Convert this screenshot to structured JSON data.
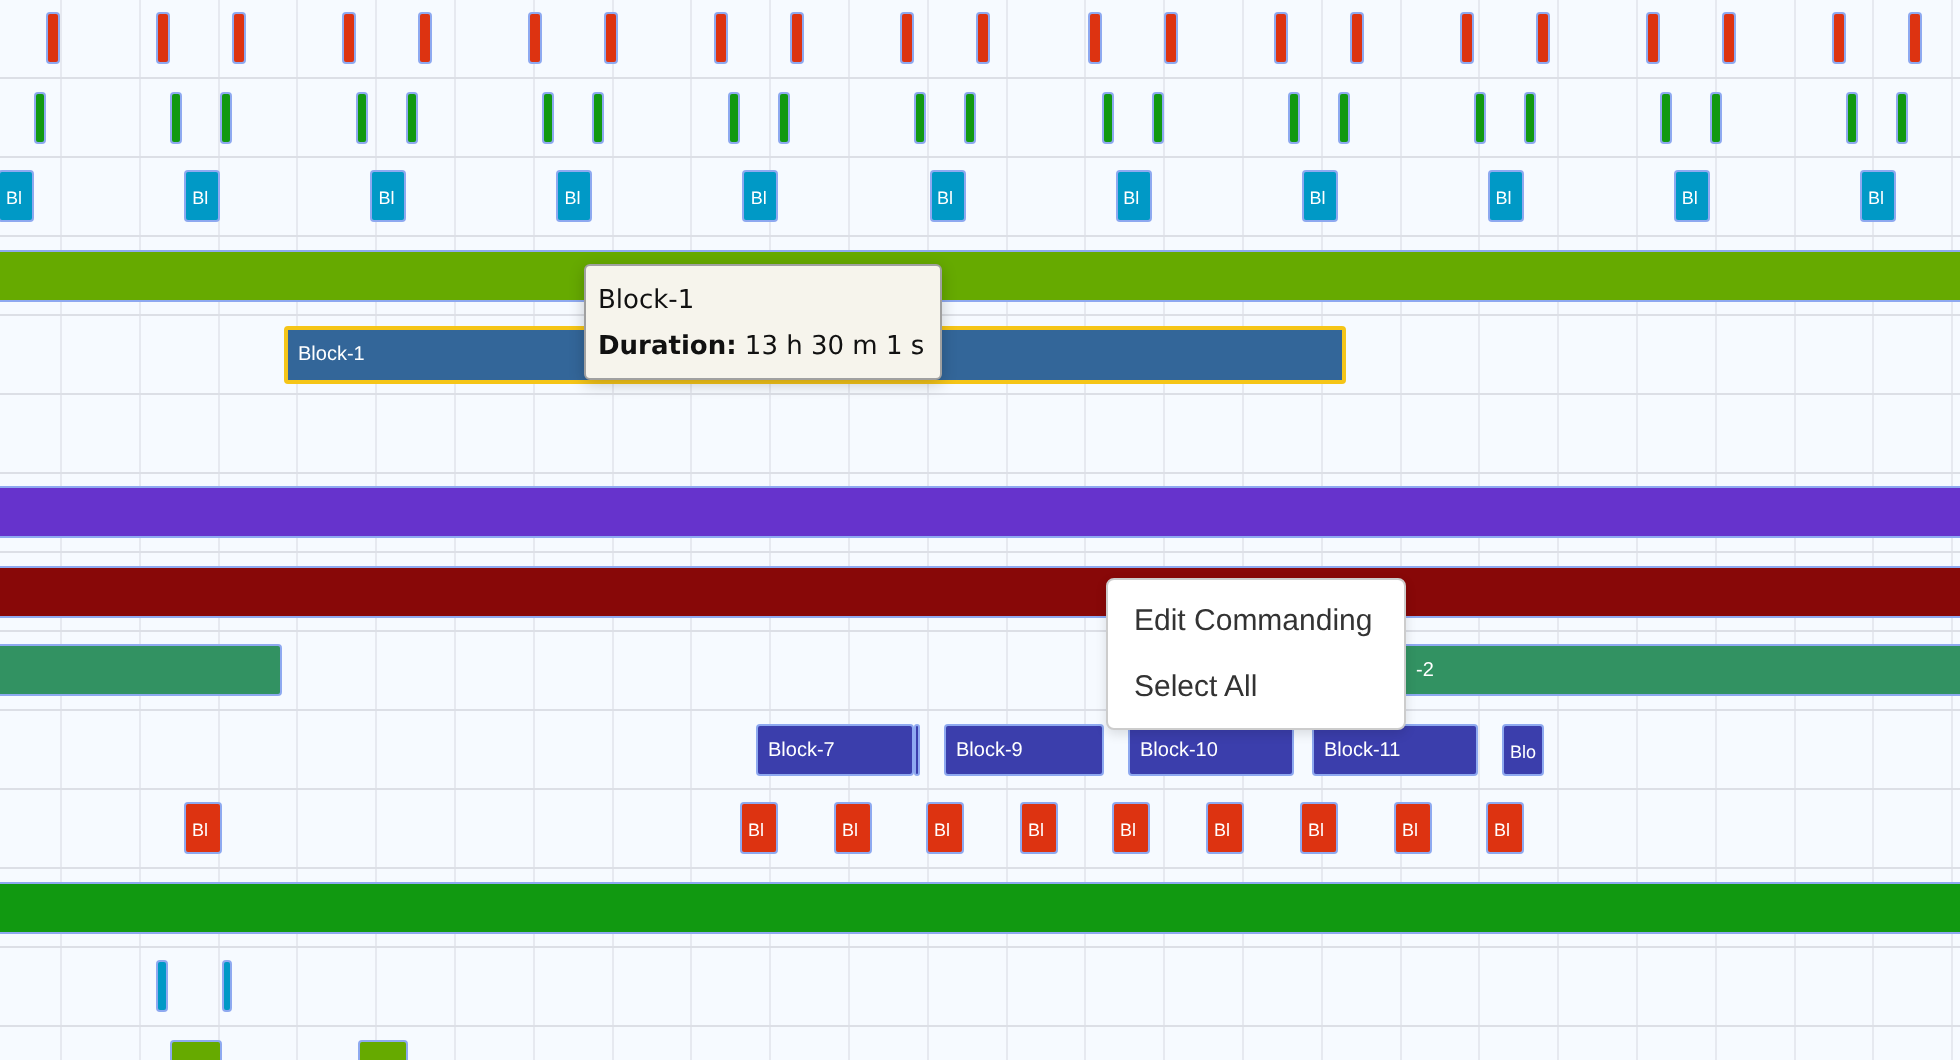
{
  "rows": [
    {
      "color": "#dd3311",
      "items": [
        {
          "kind": "tick",
          "selected": false
        },
        {
          "kind": "tick",
          "selected": false
        },
        {
          "kind": "tick",
          "selected": false
        },
        {
          "kind": "tick",
          "selected": false
        },
        {
          "kind": "tick",
          "selected": false
        },
        {
          "kind": "tick",
          "selected": false
        },
        {
          "kind": "tick",
          "selected": false
        },
        {
          "kind": "tick",
          "selected": false
        },
        {
          "kind": "tick",
          "selected": false
        },
        {
          "kind": "tick",
          "selected": false
        },
        {
          "kind": "tick",
          "selected": false
        },
        {
          "kind": "tick",
          "selected": false
        },
        {
          "kind": "tick",
          "selected": false
        },
        {
          "kind": "tick",
          "selected": false
        },
        {
          "kind": "tick",
          "selected": false
        },
        {
          "kind": "tick",
          "selected": false
        },
        {
          "kind": "tick",
          "selected": false
        },
        {
          "kind": "tick",
          "selected": false
        },
        {
          "kind": "tick",
          "selected": false
        },
        {
          "kind": "tick",
          "selected": false
        },
        {
          "kind": "tick",
          "selected": false
        }
      ]
    },
    {
      "color": "#119911",
      "items": [
        {
          "kind": "tick",
          "selected": false
        },
        {
          "kind": "tick",
          "selected": false
        },
        {
          "kind": "tick",
          "selected": false
        },
        {
          "kind": "tick",
          "selected": false
        },
        {
          "kind": "tick",
          "selected": false
        },
        {
          "kind": "tick",
          "selected": false
        },
        {
          "kind": "tick",
          "selected": false
        },
        {
          "kind": "tick",
          "selected": false
        },
        {
          "kind": "tick",
          "selected": false
        },
        {
          "kind": "tick",
          "selected": false
        },
        {
          "kind": "tick",
          "selected": false
        },
        {
          "kind": "tick",
          "selected": false
        },
        {
          "kind": "tick",
          "selected": false
        },
        {
          "kind": "tick",
          "selected": false
        },
        {
          "kind": "tick",
          "selected": false
        },
        {
          "kind": "tick",
          "selected": false
        },
        {
          "kind": "tick",
          "selected": false
        },
        {
          "kind": "tick",
          "selected": false
        },
        {
          "kind": "tick",
          "selected": false
        },
        {
          "kind": "tick",
          "selected": false
        },
        {
          "kind": "tick",
          "selected": false
        }
      ]
    },
    {
      "color": "#0099c6",
      "items": [
        {
          "kind": "block",
          "label": "Bl",
          "selected": false
        },
        {
          "kind": "block",
          "label": "Bl",
          "selected": false
        },
        {
          "kind": "block",
          "label": "Bl",
          "selected": false
        },
        {
          "kind": "block",
          "label": "Bl",
          "selected": false
        },
        {
          "kind": "block",
          "label": "Bl",
          "selected": false
        },
        {
          "kind": "block",
          "label": "Bl",
          "selected": false
        },
        {
          "kind": "block",
          "label": "Bl",
          "selected": false
        },
        {
          "kind": "block",
          "label": "Bl",
          "selected": false
        },
        {
          "kind": "block",
          "label": "Bl",
          "selected": false
        },
        {
          "kind": "block",
          "label": "Bl",
          "selected": false
        },
        {
          "kind": "block",
          "label": "Bl",
          "selected": false
        }
      ]
    },
    {
      "color": "#66aa00",
      "items": [
        {
          "kind": "bar",
          "selected": false
        }
      ]
    },
    {
      "color": "#336699",
      "items": [
        {
          "kind": "block",
          "label": "Block-1",
          "selected": true
        }
      ]
    },
    {
      "color": "#6633cc",
      "items": [
        {
          "kind": "bar",
          "selected": false
        }
      ]
    },
    {
      "color": "#880808",
      "items": [
        {
          "kind": "bar",
          "selected": false
        }
      ]
    },
    {
      "color": "#329262",
      "items": [
        {
          "kind": "bar",
          "selected": false
        },
        {
          "kind": "bar",
          "label": "-2",
          "selected": false
        }
      ]
    },
    {
      "color": "#3b3eac",
      "items": [
        {
          "kind": "block",
          "label": "Block-7",
          "selected": false
        },
        {
          "kind": "block",
          "selected": false
        },
        {
          "kind": "block",
          "label": "Block-9",
          "selected": false
        },
        {
          "kind": "block",
          "label": "Block-10",
          "selected": false
        },
        {
          "kind": "block",
          "label": "Block-11",
          "selected": false
        },
        {
          "kind": "block",
          "label": "Blo",
          "selected": false
        }
      ]
    },
    {
      "color": "#dd3311",
      "items": [
        {
          "kind": "block",
          "label": "Bl",
          "selected": false
        },
        {
          "kind": "block",
          "label": "Bl",
          "selected": false
        },
        {
          "kind": "block",
          "label": "Bl",
          "selected": false
        },
        {
          "kind": "block",
          "label": "Bl",
          "selected": false
        },
        {
          "kind": "block",
          "label": "Bl",
          "selected": false
        },
        {
          "kind": "block",
          "label": "Bl",
          "selected": false
        },
        {
          "kind": "block",
          "label": "Bl",
          "selected": false
        },
        {
          "kind": "block",
          "label": "Bl",
          "selected": false
        },
        {
          "kind": "block",
          "label": "Bl",
          "selected": false
        },
        {
          "kind": "block",
          "label": "Bl",
          "selected": false
        }
      ]
    },
    {
      "color": "#119911",
      "items": [
        {
          "kind": "bar",
          "selected": false
        }
      ]
    },
    {
      "color": "#0099c6",
      "items": [
        {
          "kind": "tick",
          "selected": false
        },
        {
          "kind": "tick",
          "selected": false
        }
      ]
    },
    {
      "color": "#66aa00",
      "items": [
        {
          "kind": "block",
          "selected": false
        },
        {
          "kind": "block",
          "selected": false
        }
      ]
    }
  ],
  "tooltip": {
    "title": "Block-1",
    "text": "**Duration:** 13 h 30 m 1 s"
  },
  "context_menu": {
    "items": [
      {
        "label": "Edit Commanding"
      },
      {
        "label": "Select All"
      }
    ]
  }
}
